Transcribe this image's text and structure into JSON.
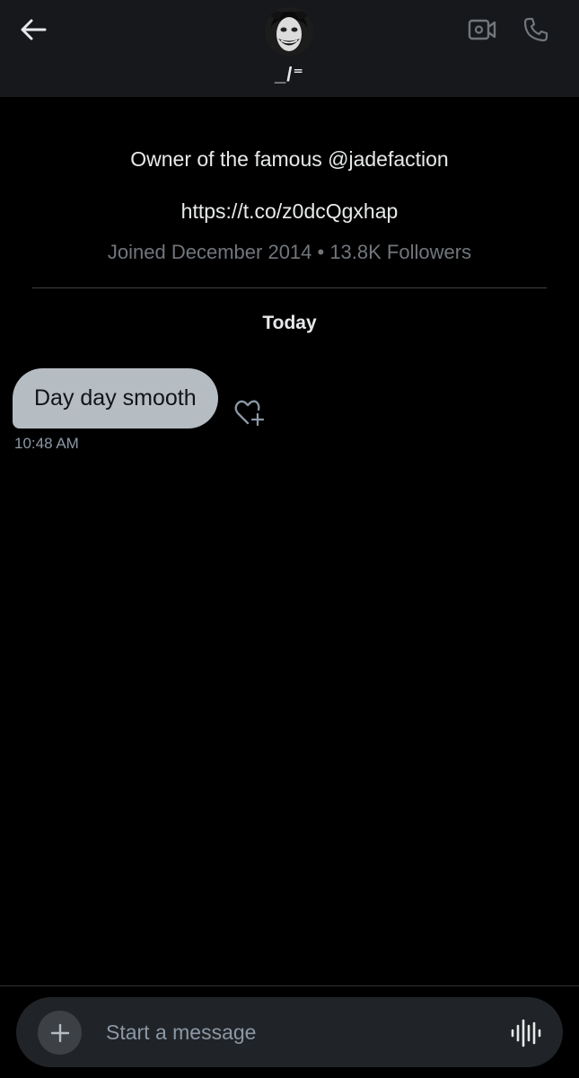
{
  "header": {
    "name": "_/⁼",
    "avatar_icon": "joker-avatar",
    "back_icon": "arrow-left-icon",
    "video_icon": "video-camera-icon",
    "call_icon": "phone-icon"
  },
  "profile": {
    "bio": "Owner of the famous @jadefaction",
    "link": "https://t.co/z0dcQgxhap",
    "meta": "Joined December 2014 • 13.8K Followers"
  },
  "conversation": {
    "date_label": "Today",
    "messages": [
      {
        "text": "Day day smooth",
        "time": "10:48 AM"
      }
    ]
  },
  "composer": {
    "placeholder": "Start a message",
    "add_icon": "plus-icon",
    "voice_icon": "voice-waveform-icon"
  },
  "colors": {
    "background": "#000000",
    "header_bg": "#16181c",
    "bubble_bg": "#b5bcc2",
    "muted_text": "#71767b",
    "composer_bg": "#202327"
  }
}
